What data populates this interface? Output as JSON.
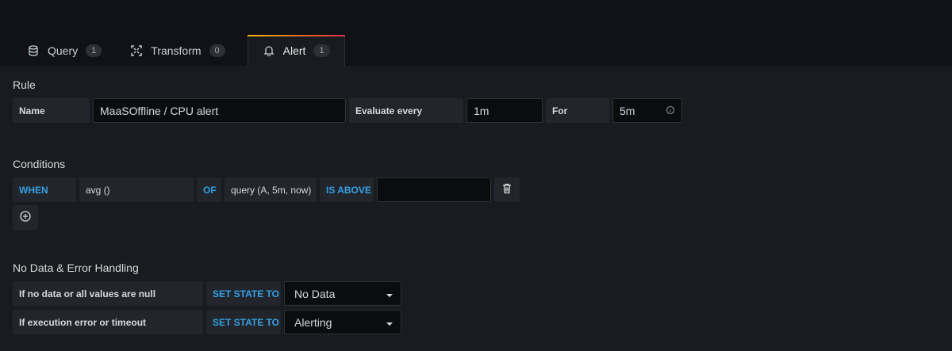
{
  "tabs": [
    {
      "label": "Query",
      "count": "1",
      "icon": "database-icon"
    },
    {
      "label": "Transform",
      "count": "0",
      "icon": "transform-icon"
    },
    {
      "label": "Alert",
      "count": "1",
      "icon": "bell-icon",
      "active": true
    }
  ],
  "rule": {
    "title": "Rule",
    "name_label": "Name",
    "name_value": "MaaSOffline / CPU alert",
    "evaluate_label": "Evaluate every",
    "evaluate_value": "1m",
    "for_label": "For",
    "for_value": "5m"
  },
  "conditions": {
    "title": "Conditions",
    "when": "WHEN",
    "reducer": "avg ()",
    "of": "OF",
    "query": "query (A, 5m, now)",
    "evaluator": "IS ABOVE",
    "threshold": ""
  },
  "no_data": {
    "title": "No Data & Error Handling",
    "rows": [
      {
        "label": "If no data or all values are null",
        "keyword": "SET STATE TO",
        "value": "No Data"
      },
      {
        "label": "If execution error or timeout",
        "keyword": "SET STATE TO",
        "value": "Alerting"
      }
    ]
  },
  "colors": {
    "accent": "#33a2e5",
    "background": "#181b1f"
  }
}
